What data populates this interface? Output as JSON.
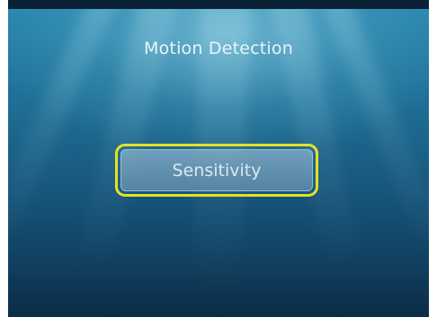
{
  "screen": {
    "title": "Motion Detection"
  },
  "menu": {
    "items": [
      {
        "label": "Sensitivity",
        "selected": true
      }
    ]
  },
  "colors": {
    "focus_ring": "#e6e023",
    "background_top": "#2a86ad",
    "background_bottom": "#0a2d45",
    "text": "#e8f4fa"
  }
}
